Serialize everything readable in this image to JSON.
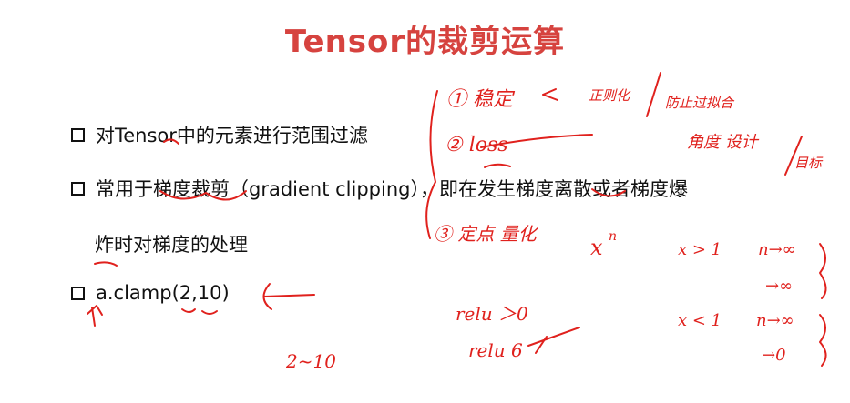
{
  "title": "Tensor的裁剪运算",
  "bullets": [
    {
      "text": "对Tensor中的元素进行范围过滤"
    },
    {
      "text": "常用于梯度裁剪（gradient clipping），即在发生梯度离散或者梯度爆",
      "continuation": "炸时对梯度的处理"
    },
    {
      "text": "a.clamp(2,10)"
    }
  ],
  "annotations": {
    "n1": "① 稳定",
    "n1_note": "正则化",
    "n1_note2": "防止过拟合",
    "n2": "② loss",
    "n2_note": "角度 设计",
    "n2_note2": "目标",
    "n3": "③ 定点 量化",
    "xn": "x",
    "xn_sup": "n",
    "c1": "x > 1",
    "c1_lim": "n→∞",
    "c1_res": "→∞",
    "c2": "x < 1",
    "c2_lim": "n→∞",
    "c2_res": "→0",
    "relu1": "relu ＞0",
    "relu2": "relu 6",
    "range": "2~10"
  },
  "colors": {
    "title": "#d6433f",
    "ink": "#e0211d",
    "text": "#111111"
  }
}
